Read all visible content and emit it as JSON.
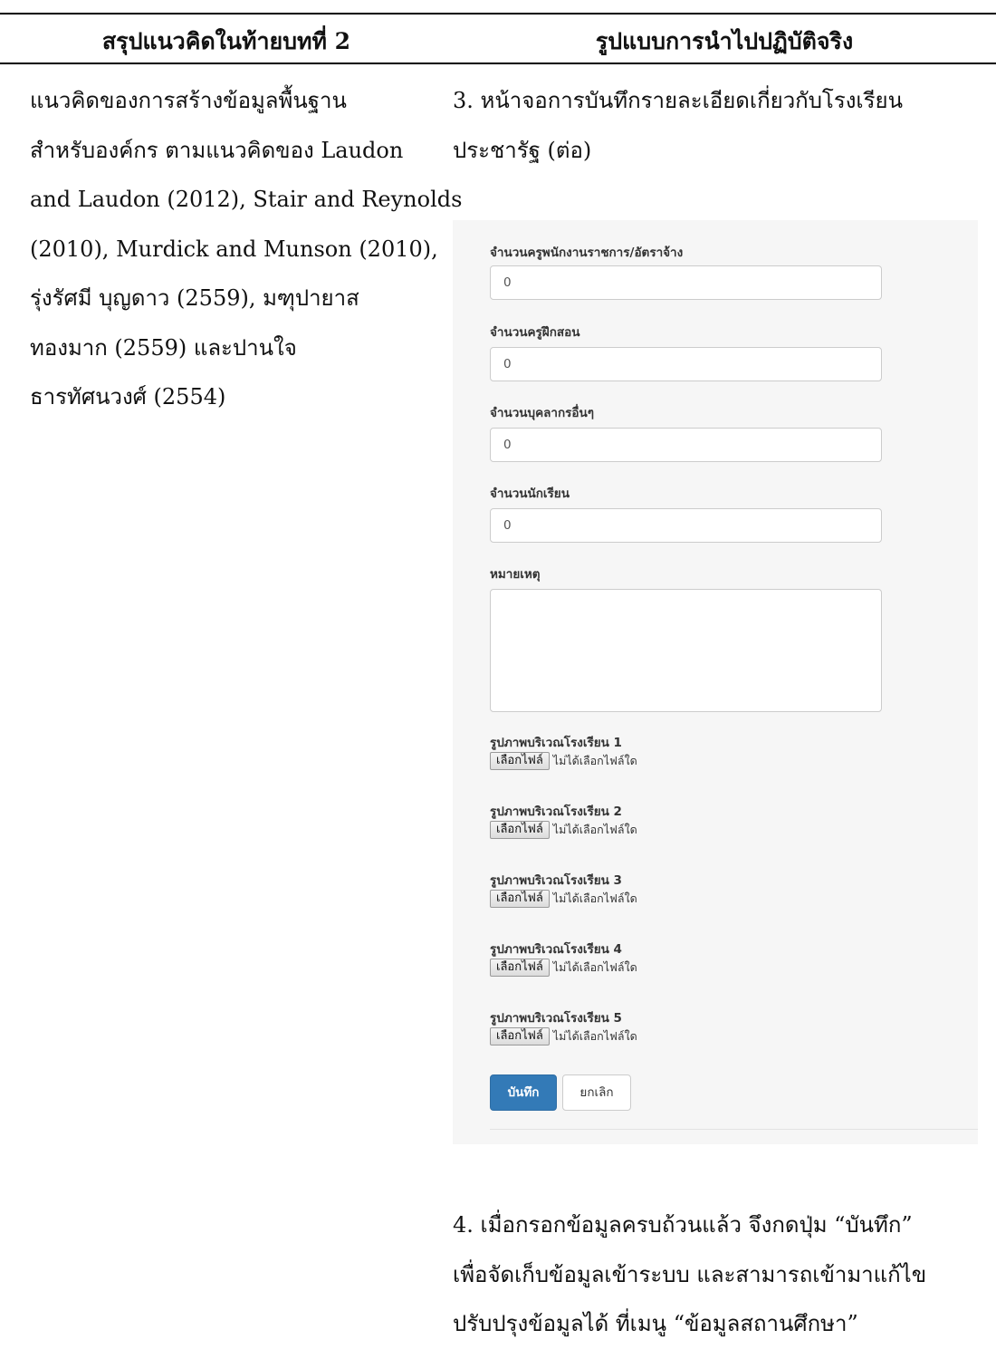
{
  "header": {
    "left": "สรุปแนวคิดในท้ายบทที่ 2",
    "right": "รูปแบบการนำไปปฏิบัติจริง"
  },
  "left_column": {
    "lines": [
      "แนวคิดของการสร้างข้อมูลพื้นฐาน",
      "สำหรับองค์กร ตามแนวคิดของ Laudon",
      "and Laudon (2012), Stair and Reynolds",
      "(2010), Murdick and Munson (2010),",
      "รุ่งรัศมี บุญดาว (2559), มฑุปายาส",
      "ทองมาก (2559) และปานใจ",
      "ธารทัศนวงศ์ (2554)"
    ]
  },
  "right_column": {
    "step3_lines": [
      "3. หน้าจอการบันทึกรายละเอียดเกี่ยวกับโรงเรียน",
      "ประชารัฐ (ต่อ)"
    ],
    "step4_lines": [
      "4. เมื่อกรอกข้อมูลครบถ้วนแล้ว จึงกดปุ่ม “บันทึก”",
      "เพื่อจัดเก็บข้อมูลเข้าระบบ และสามารถเข้ามาแก้ไข",
      "ปรับปรุงข้อมูลได้ ที่เมนู “ข้อมูลสถานศึกษา”"
    ]
  },
  "form": {
    "fields": [
      {
        "label": "จำนวนครูพนักงานราชการ/อัตราจ้าง",
        "value": "0"
      },
      {
        "label": "จำนวนครูฝึกสอน",
        "value": "0"
      },
      {
        "label": "จำนวนบุคลากรอื่นๆ",
        "value": "0"
      },
      {
        "label": "จำนวนนักเรียน",
        "value": "0"
      }
    ],
    "remark_label": "หมายเหตุ",
    "remark_value": "",
    "files": [
      {
        "label": "รูปภาพบริเวณโรงเรียน 1",
        "button": "เลือกไฟล์",
        "status": "ไม่ได้เลือกไฟล์ใด"
      },
      {
        "label": "รูปภาพบริเวณโรงเรียน 2",
        "button": "เลือกไฟล์",
        "status": "ไม่ได้เลือกไฟล์ใด"
      },
      {
        "label": "รูปภาพบริเวณโรงเรียน 3",
        "button": "เลือกไฟล์",
        "status": "ไม่ได้เลือกไฟล์ใด"
      },
      {
        "label": "รูปภาพบริเวณโรงเรียน 4",
        "button": "เลือกไฟล์",
        "status": "ไม่ได้เลือกไฟล์ใด"
      },
      {
        "label": "รูปภาพบริเวณโรงเรียน 5",
        "button": "เลือกไฟล์",
        "status": "ไม่ได้เลือกไฟล์ใด"
      }
    ],
    "save_label": "บันทึก",
    "cancel_label": "ยกเลิก"
  },
  "colors": {
    "primary_button": "#337ab7",
    "panel_background": "#f6f6f6"
  }
}
